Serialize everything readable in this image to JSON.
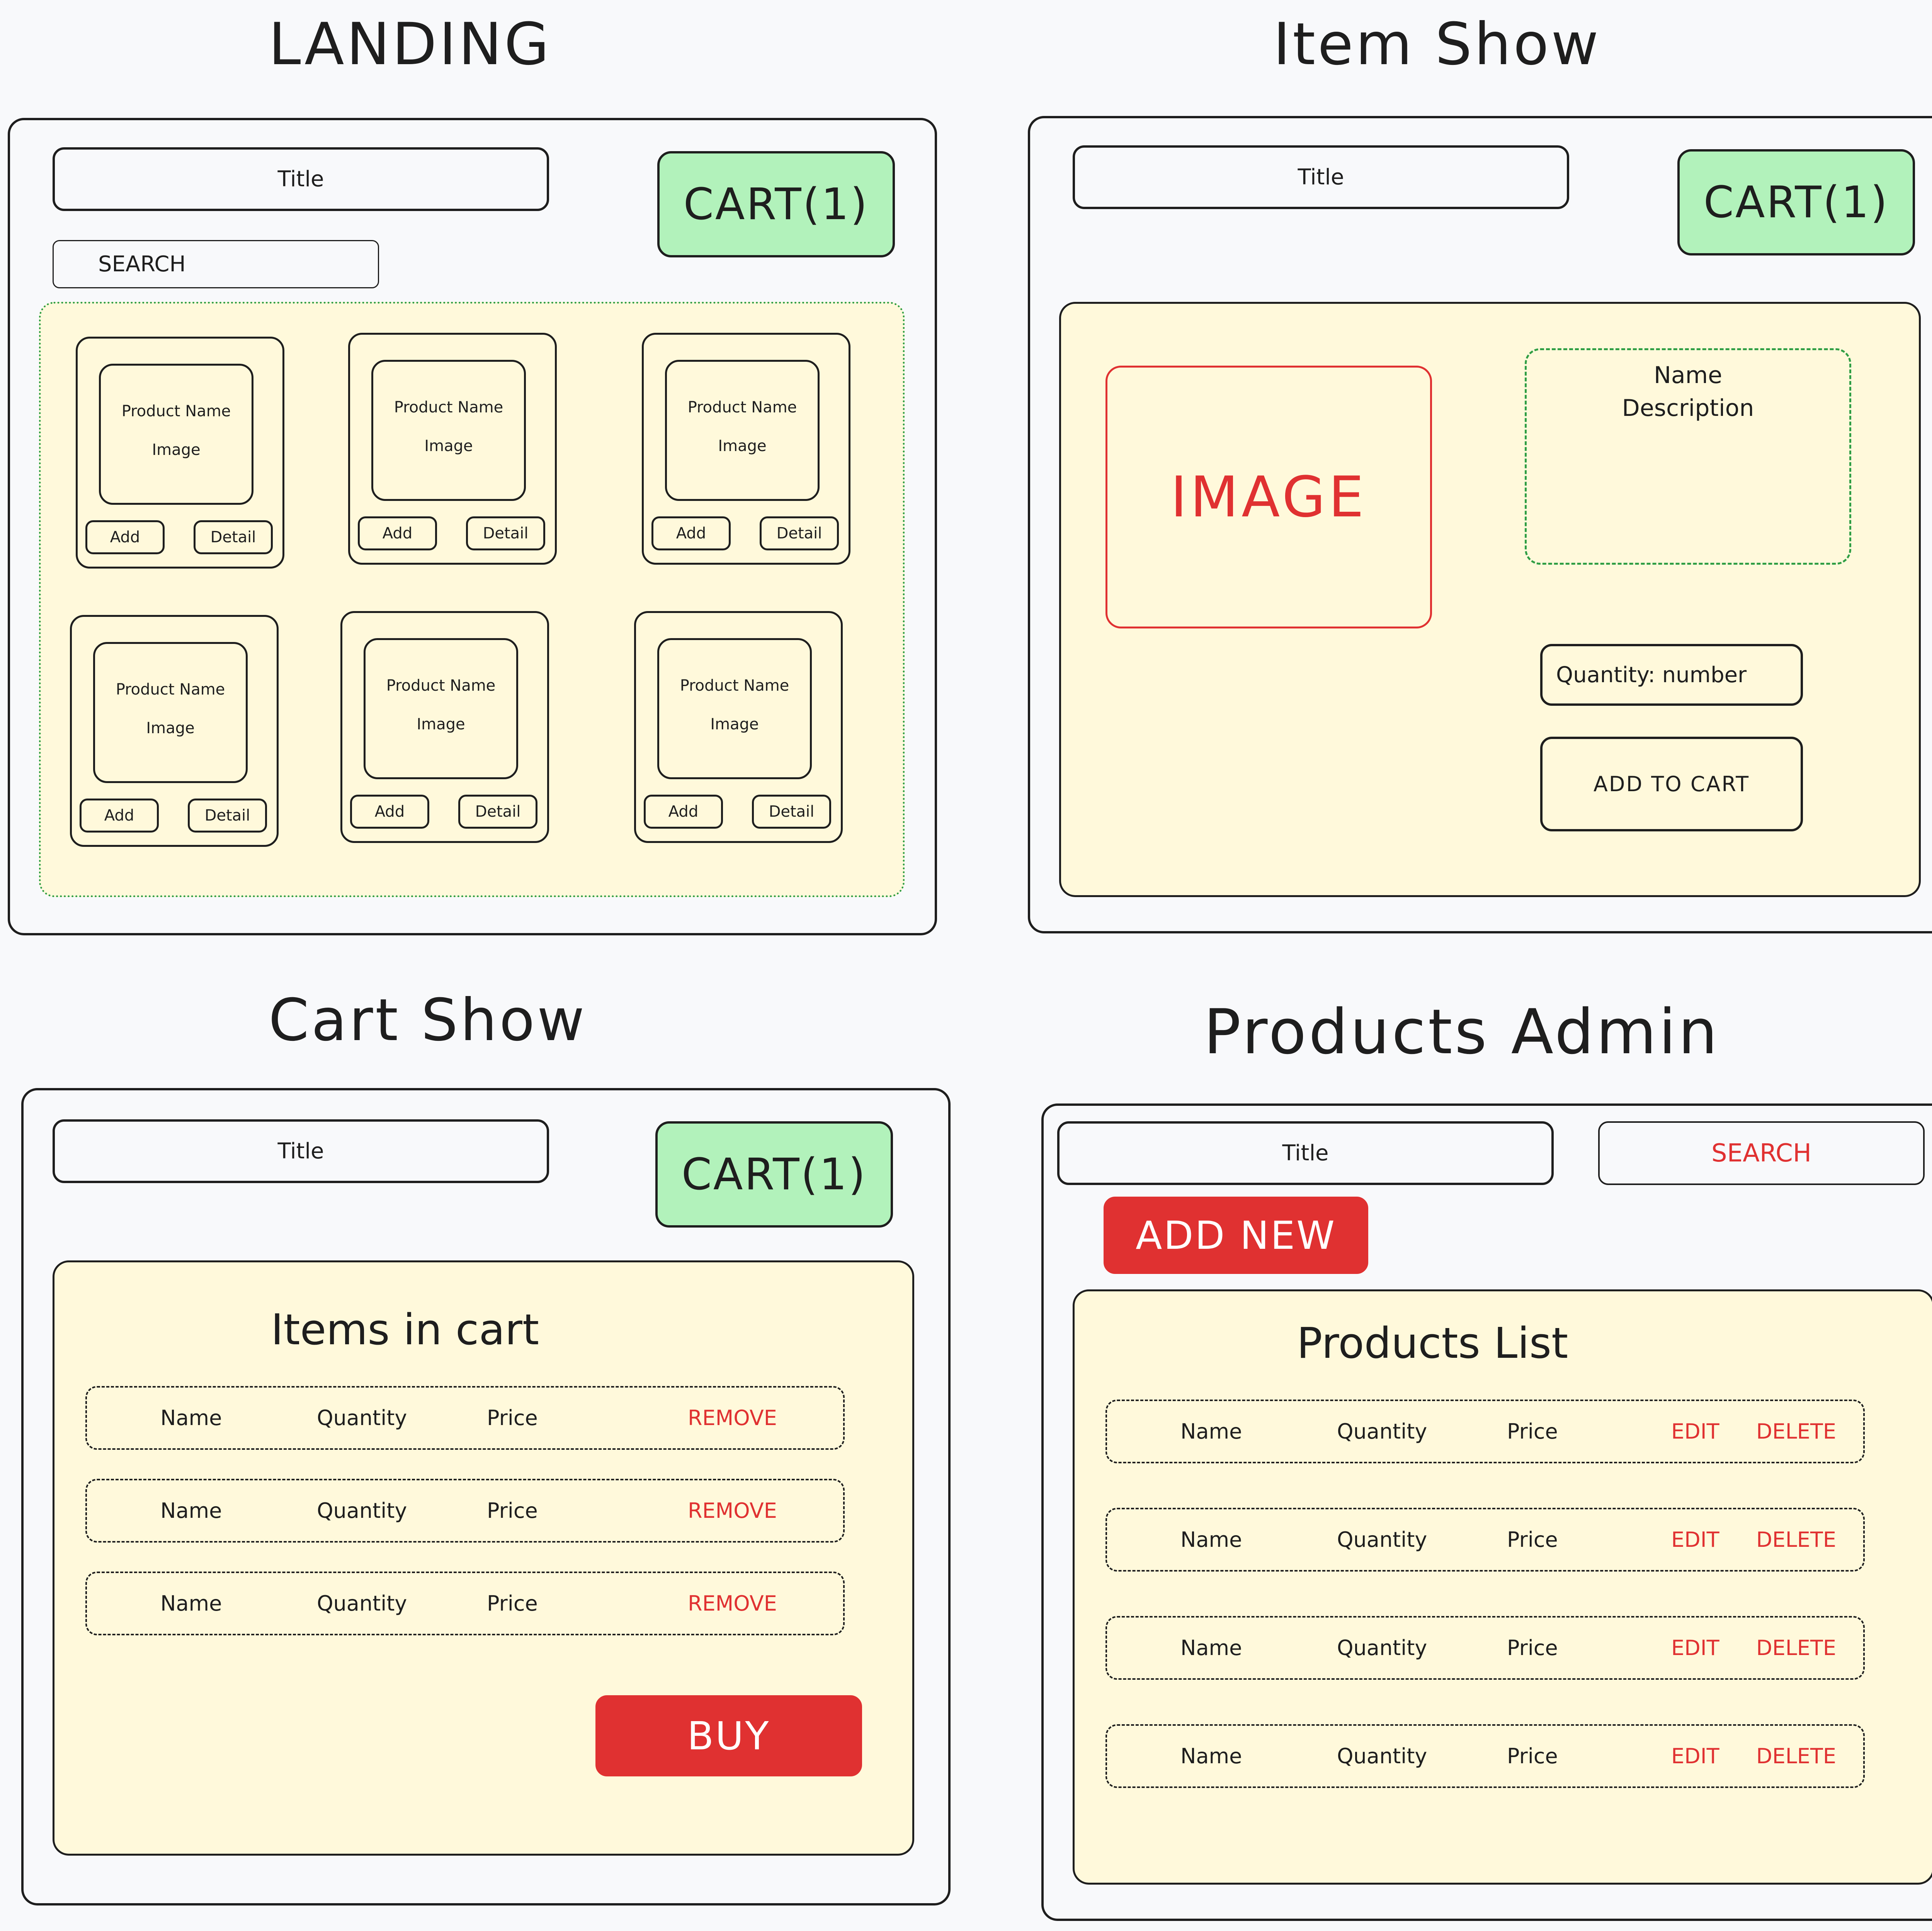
{
  "landing": {
    "heading": "LANDING",
    "title": "Title",
    "cart": "CART(1)",
    "search": "SEARCH",
    "products": [
      {
        "name": "Product Name",
        "image": "Image",
        "add": "Add",
        "detail": "Detail"
      },
      {
        "name": "Product Name",
        "image": "Image",
        "add": "Add",
        "detail": "Detail"
      },
      {
        "name": "Product Name",
        "image": "Image",
        "add": "Add",
        "detail": "Detail"
      },
      {
        "name": "Product Name",
        "image": "Image",
        "add": "Add",
        "detail": "Detail"
      },
      {
        "name": "Product Name",
        "image": "Image",
        "add": "Add",
        "detail": "Detail"
      },
      {
        "name": "Product Name",
        "image": "Image",
        "add": "Add",
        "detail": "Detail"
      }
    ]
  },
  "item_show": {
    "heading": "Item Show",
    "title": "Title",
    "cart": "CART(1)",
    "image": "IMAGE",
    "name": "Name",
    "description": "Description",
    "quantity": "Quantity: number",
    "add_to_cart": "ADD TO CART"
  },
  "cart_show": {
    "heading": "Cart Show",
    "title": "Title",
    "cart": "CART(1)",
    "list_title": "Items in cart",
    "rows": [
      {
        "name": "Name",
        "quantity": "Quantity",
        "price": "Price",
        "action": "REMOVE"
      },
      {
        "name": "Name",
        "quantity": "Quantity",
        "price": "Price",
        "action": "REMOVE"
      },
      {
        "name": "Name",
        "quantity": "Quantity",
        "price": "Price",
        "action": "REMOVE"
      }
    ],
    "buy": "BUY"
  },
  "products_admin": {
    "heading": "Products Admin",
    "title": "Title",
    "search": "SEARCH",
    "add_new": "ADD NEW",
    "list_title": "Products List",
    "rows": [
      {
        "name": "Name",
        "quantity": "Quantity",
        "price": "Price",
        "edit": "EDIT",
        "delete": "DELETE"
      },
      {
        "name": "Name",
        "quantity": "Quantity",
        "price": "Price",
        "edit": "EDIT",
        "delete": "DELETE"
      },
      {
        "name": "Name",
        "quantity": "Quantity",
        "price": "Price",
        "edit": "EDIT",
        "delete": "DELETE"
      },
      {
        "name": "Name",
        "quantity": "Quantity",
        "price": "Price",
        "edit": "EDIT",
        "delete": "DELETE"
      }
    ]
  },
  "colors": {
    "cart_green": "#b2f2bb",
    "panel_yellow": "#fff9db",
    "accent_red": "#e03131",
    "dotted_green": "#2f9e44",
    "stroke": "#1e1e1e",
    "background": "#f8f9fb"
  }
}
